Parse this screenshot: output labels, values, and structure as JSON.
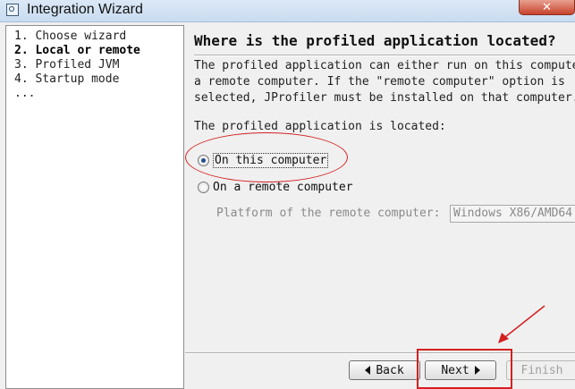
{
  "window": {
    "title": "Integration Wizard",
    "close_glyph": "✕",
    "icon": "app-window-icon",
    "accent_color": "#d42020"
  },
  "steps": [
    {
      "label": "1. Choose wizard",
      "current": false
    },
    {
      "label": "2. Local or remote",
      "current": true
    },
    {
      "label": "3. Profiled JVM",
      "current": false
    },
    {
      "label": "4. Startup mode",
      "current": false
    },
    {
      "label": "...",
      "current": false
    }
  ],
  "main": {
    "heading": "Where is the profiled application located?",
    "description": [
      "The profiled application can either run on this computer or on",
      "a remote computer. If the \"remote computer\" option is",
      "selected, JProfiler must be installed on that computer."
    ],
    "located_label": "The profiled application is located:",
    "options": [
      {
        "label": "On this computer",
        "checked": true
      },
      {
        "label": "On a remote computer",
        "checked": false
      }
    ],
    "platform_label": "Platform of the remote computer:",
    "platform_value": "Windows X86/AMD64"
  },
  "buttons": {
    "back": "Back",
    "next": "Next",
    "finish": "Finish"
  }
}
